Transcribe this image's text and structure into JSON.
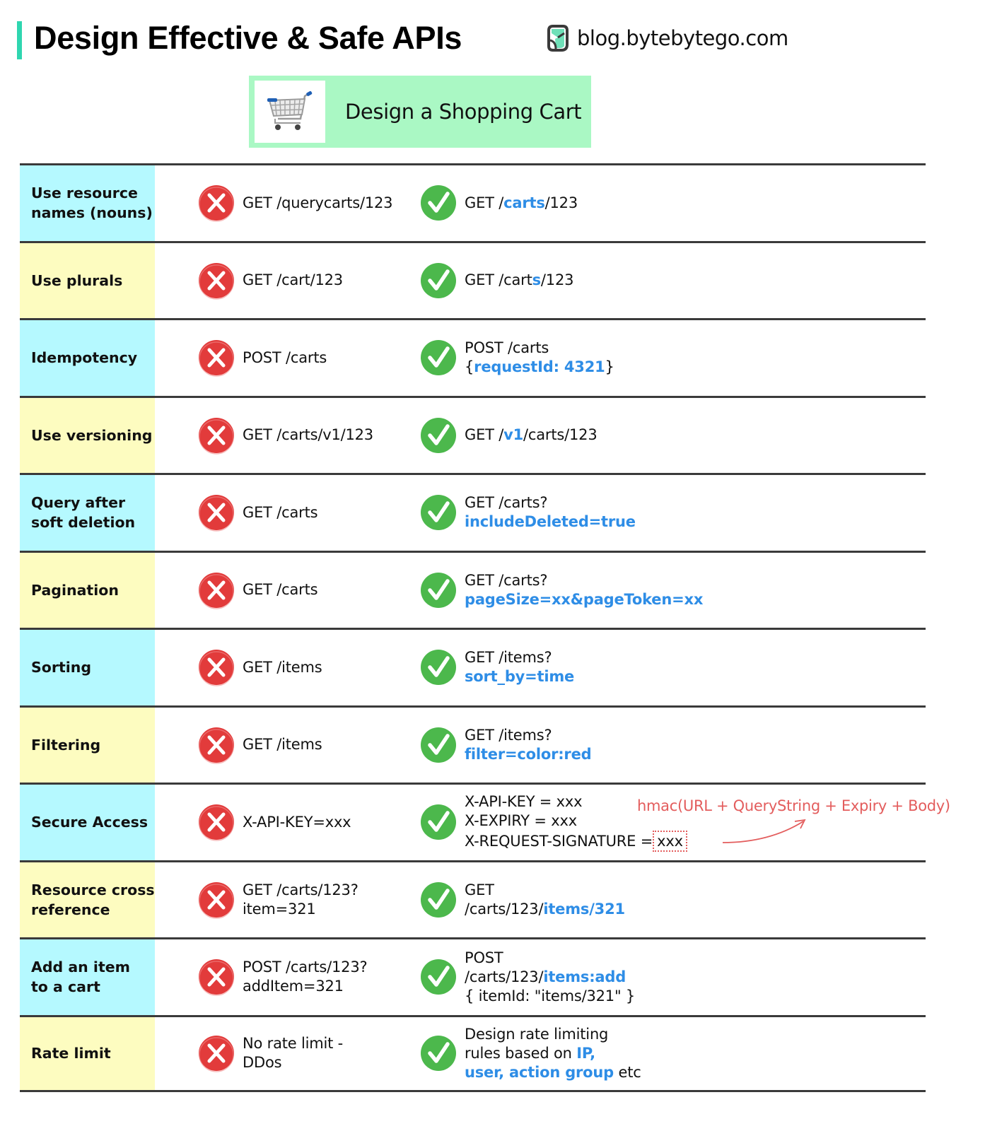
{
  "header": {
    "title": "Design Effective & Safe APIs",
    "brand": "blog.bytebytego.com",
    "brand_icon": "bytebytego-logo-icon",
    "accent_color": "#2fd6b0"
  },
  "banner": {
    "text": "Design a Shopping Cart",
    "icon": "shopping-cart-icon",
    "bg_color": "#aaf8c4"
  },
  "colors": {
    "highlight": "#2e8de6",
    "bad": "#e23b3b",
    "good": "#4cb84c",
    "annotation": "#e35d5d",
    "label_cyan": "#b5f9ff",
    "label_yellow": "#fdfcc0"
  },
  "rows": [
    {
      "label": "Use resource\nnames (nouns)",
      "color": "cyan",
      "bad": [
        {
          "t": "GET /querycarts/123"
        }
      ],
      "good": [
        {
          "t": "GET /"
        },
        {
          "t": "carts",
          "hl": true
        },
        {
          "t": "/123"
        }
      ]
    },
    {
      "label": "Use plurals",
      "color": "yellow",
      "bad": [
        {
          "t": "GET /cart/123"
        }
      ],
      "good": [
        {
          "t": "GET /cart"
        },
        {
          "t": "s",
          "hl": true
        },
        {
          "t": "/123"
        }
      ]
    },
    {
      "label": "Idempotency",
      "color": "cyan",
      "bad": [
        {
          "t": "POST /carts"
        }
      ],
      "good": [
        {
          "t": "POST /carts\n{"
        },
        {
          "t": "requestId: 4321",
          "hl": true
        },
        {
          "t": "}"
        }
      ]
    },
    {
      "label": "Use versioning",
      "color": "yellow",
      "bad": [
        {
          "t": "GET /carts/v1/123"
        }
      ],
      "good": [
        {
          "t": "GET /"
        },
        {
          "t": "v1",
          "hl": true
        },
        {
          "t": "/carts/123"
        }
      ]
    },
    {
      "label": "Query after\nsoft deletion",
      "color": "cyan",
      "bad": [
        {
          "t": "GET /carts"
        }
      ],
      "good": [
        {
          "t": "GET /carts?\n"
        },
        {
          "t": "includeDeleted=true",
          "hl": true
        }
      ]
    },
    {
      "label": "Pagination",
      "color": "yellow",
      "bad": [
        {
          "t": "GET /carts"
        }
      ],
      "good": [
        {
          "t": "GET /carts?\n"
        },
        {
          "t": "pageSize=xx&pageToken=xx",
          "hl": true
        }
      ]
    },
    {
      "label": "Sorting",
      "color": "cyan",
      "bad": [
        {
          "t": "GET /items"
        }
      ],
      "good": [
        {
          "t": "GET /items?\n"
        },
        {
          "t": "sort_by=time",
          "hl": true
        }
      ]
    },
    {
      "label": "Filtering",
      "color": "yellow",
      "bad": [
        {
          "t": "GET /items"
        }
      ],
      "good": [
        {
          "t": "GET /items?\n"
        },
        {
          "t": "filter=color:red",
          "hl": true
        }
      ]
    },
    {
      "label": "Secure Access",
      "color": "cyan",
      "bad": [
        {
          "t": "X-API-KEY=xxx"
        }
      ],
      "good": [
        {
          "t": "X-API-KEY = xxx\nX-EXPIRY = xxx\nX-REQUEST-SIGNATURE ="
        },
        {
          "t": "xxx",
          "box": true
        }
      ],
      "note": "hmac(URL + QueryString + Expiry + Body)"
    },
    {
      "label": "Resource cross\nreference",
      "color": "yellow",
      "bad": [
        {
          "t": "GET /carts/123?\nitem=321"
        }
      ],
      "good": [
        {
          "t": "GET\n/carts/123/"
        },
        {
          "t": "items/321",
          "hl": true
        }
      ]
    },
    {
      "label": "Add an item\nto a cart",
      "color": "cyan",
      "bad": [
        {
          "t": "POST /carts/123?\naddItem=321"
        }
      ],
      "good": [
        {
          "t": "POST\n/carts/123/"
        },
        {
          "t": "items:add",
          "hl": true
        },
        {
          "t": "\n{ itemId: \"items/321\" }"
        }
      ]
    },
    {
      "label": "Rate limit",
      "color": "yellow",
      "bad": [
        {
          "t": "No rate limit -\nDDos"
        }
      ],
      "good": [
        {
          "t": "Design rate limiting\nrules based on "
        },
        {
          "t": "IP,",
          "hl": true
        },
        {
          "t": "\n"
        },
        {
          "t": "user, action group",
          "hl": true
        },
        {
          "t": " etc"
        }
      ]
    }
  ]
}
